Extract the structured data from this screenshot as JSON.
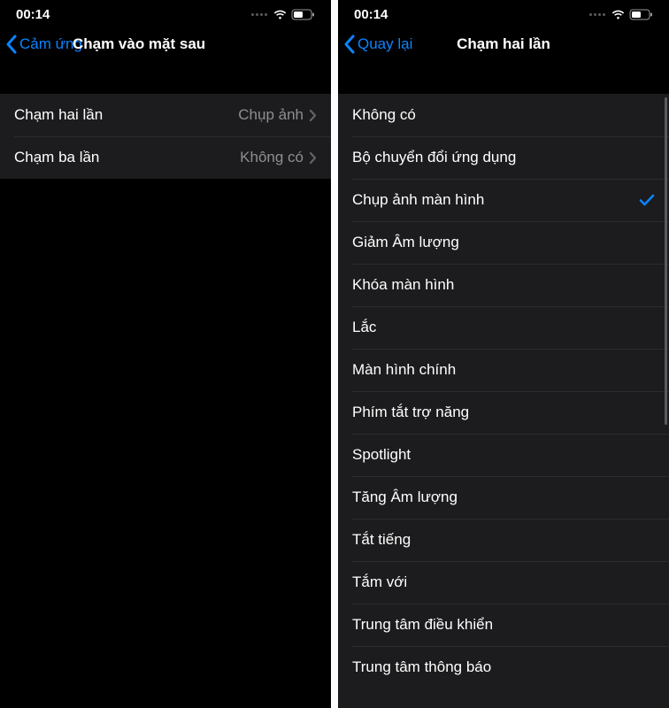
{
  "status": {
    "time": "00:14"
  },
  "left": {
    "back_label": "Cảm ứng",
    "title": "Chạm vào mặt sau",
    "rows": [
      {
        "label": "Chạm hai lần",
        "value": "Chụp ảnh"
      },
      {
        "label": "Chạm ba lần",
        "value": "Không có"
      }
    ]
  },
  "right": {
    "back_label": "Quay lại",
    "title": "Chạm hai lần",
    "options": [
      {
        "label": "Không có",
        "selected": false
      },
      {
        "label": "Bộ chuyển đổi ứng dụng",
        "selected": false
      },
      {
        "label": "Chụp ảnh màn hình",
        "selected": true
      },
      {
        "label": "Giảm Âm lượng",
        "selected": false
      },
      {
        "label": "Khóa màn hình",
        "selected": false
      },
      {
        "label": "Lắc",
        "selected": false
      },
      {
        "label": "Màn hình chính",
        "selected": false
      },
      {
        "label": "Phím tắt trợ năng",
        "selected": false
      },
      {
        "label": "Spotlight",
        "selected": false
      },
      {
        "label": "Tăng Âm lượng",
        "selected": false
      },
      {
        "label": "Tắt tiếng",
        "selected": false
      },
      {
        "label": "Tắm với",
        "selected": false
      },
      {
        "label": "Trung tâm điều khiển",
        "selected": false
      },
      {
        "label": "Trung tâm thông báo",
        "selected": false
      }
    ]
  }
}
